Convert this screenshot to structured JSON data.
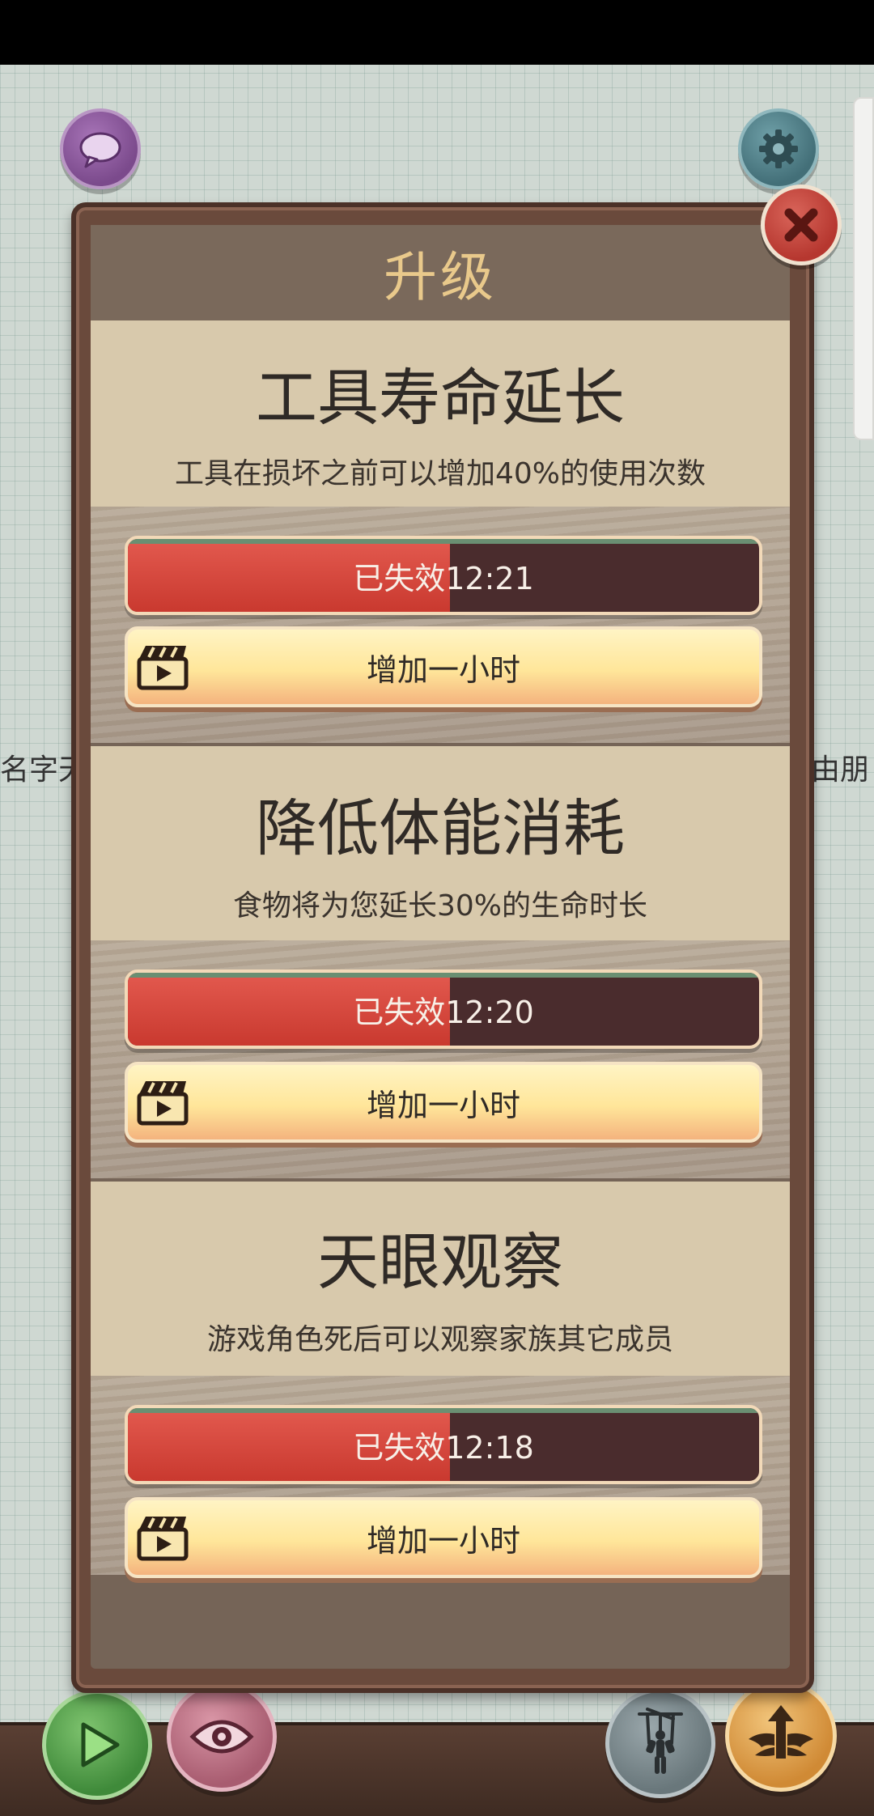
{
  "modal": {
    "title": "升级",
    "upgrades": [
      {
        "title": "工具寿命延长",
        "description": "工具在损坏之前可以增加40%的使用次数",
        "status": "已失效12:21",
        "progress_fraction": 0.51,
        "button_label": "增加一小时"
      },
      {
        "title": "降低体能消耗",
        "description": "食物将为您延长30%的生命时长",
        "status": "已失效12:20",
        "progress_fraction": 0.51,
        "button_label": "增加一小时"
      },
      {
        "title": "天眼观察",
        "description": "游戏角色死后可以观察家族其它成员",
        "status": "已失效12:18",
        "progress_fraction": 0.51,
        "button_label": "增加一小时"
      }
    ]
  },
  "background": {
    "left_text": "名字天",
    "right_text": "由朋"
  },
  "icons": {
    "chat": "chat-bubble-icon",
    "settings": "gear-icon",
    "close": "close-x-icon",
    "play": "play-icon",
    "view": "eye-icon",
    "puppet": "puppet-icon",
    "upgrade": "winged-arrow-icon",
    "video": "clapperboard-icon"
  },
  "colors": {
    "close_button": "#b6372f",
    "timer_fill": "#d8443a",
    "timer_empty": "#4a2c2d",
    "add_button": "#ffe69a",
    "title_color": "#e9c98b"
  }
}
